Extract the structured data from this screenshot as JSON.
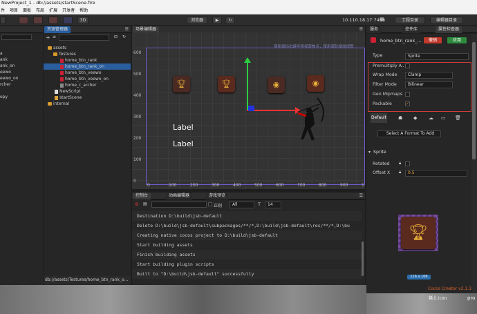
{
  "window": {
    "title": "NewProject_1 - db://assets/startScene.fire"
  },
  "menu": [
    "件",
    "项目",
    "面板",
    "布局",
    "扩展",
    "开发者",
    "帮助"
  ],
  "toolbar": {
    "preview_label": "浏览器",
    "server": "10.110.18.17:7456",
    "project_btn": "工程目录",
    "editor_btn": "编辑器目录",
    "mode": "3D"
  },
  "assets": {
    "tab": "资源管理器",
    "items": [
      "assets",
      "Testures",
      "home_btn_rank",
      "home_btn_rank_on",
      "home_btn_veewo",
      "home_btn_veewo_on",
      "home_c_archer",
      "NewScript",
      "startScene",
      "internal"
    ],
    "status": "db://assets/Testures/home_btn_rank_o..."
  },
  "hierarchy": {
    "items": [
      "a",
      "ank",
      "ank_on",
      "eewo",
      "eewo_on",
      "rcher",
      "opy"
    ]
  },
  "scene": {
    "tab": "场景编辑器",
    "hint": "使用鼠标右键平移视窗焦点，使用滚轮缩放视图",
    "label1": "Label",
    "label2": "Label",
    "yticks": [
      "600",
      "500",
      "400",
      "300",
      "200",
      "100",
      "0"
    ],
    "xticks": [
      "0",
      "100",
      "200",
      "300",
      "400",
      "500",
      "600",
      "700",
      "800",
      "900",
      "1"
    ]
  },
  "console": {
    "tabs": [
      "控制台",
      "动画编辑器",
      "游戏预览"
    ],
    "filter_regex": "正则",
    "filter_level": "All",
    "font_size": "14",
    "lines": [
      "Destination D:\\build\\jsb-default",
      "Delete D:\\build\\jsb-default\\subpackages/**/*,D:\\build\\jsb-default\\res/**/*,D:\\bu",
      "Creating native cocos project to D:\\build\\jsb-default",
      "Start building assets",
      "Finish building assets",
      "Start building plugin scripts",
      "Built to \"D:\\build\\jsb-default\" successfully"
    ]
  },
  "inspector": {
    "tabs": [
      "服务",
      "控件库",
      "属性检查器"
    ],
    "asset_name": "home_btn_rank_...",
    "revert": "撤销",
    "apply": "应用",
    "type_label": "Type",
    "type_value": "Sprite",
    "premultiply": "Premultiply A..",
    "wrap_label": "Wrap Mode",
    "wrap_value": "Clamp",
    "filter_label": "Filter Mode",
    "filter_value": "Bilinear",
    "mipmaps": "Gen Mipmaps",
    "packable": "Packable",
    "platform_default": "Default",
    "format_btn": "Select A Format To Add",
    "sprite_section": "Sprite",
    "rotated": "Rotated",
    "offset_label": "Offset X",
    "offset_value": "0.5",
    "size": "116 x 106",
    "version": "Cocos Creator v2.1.3"
  },
  "desktop": {
    "text1": "稀土.icon",
    "text2": "pro"
  }
}
